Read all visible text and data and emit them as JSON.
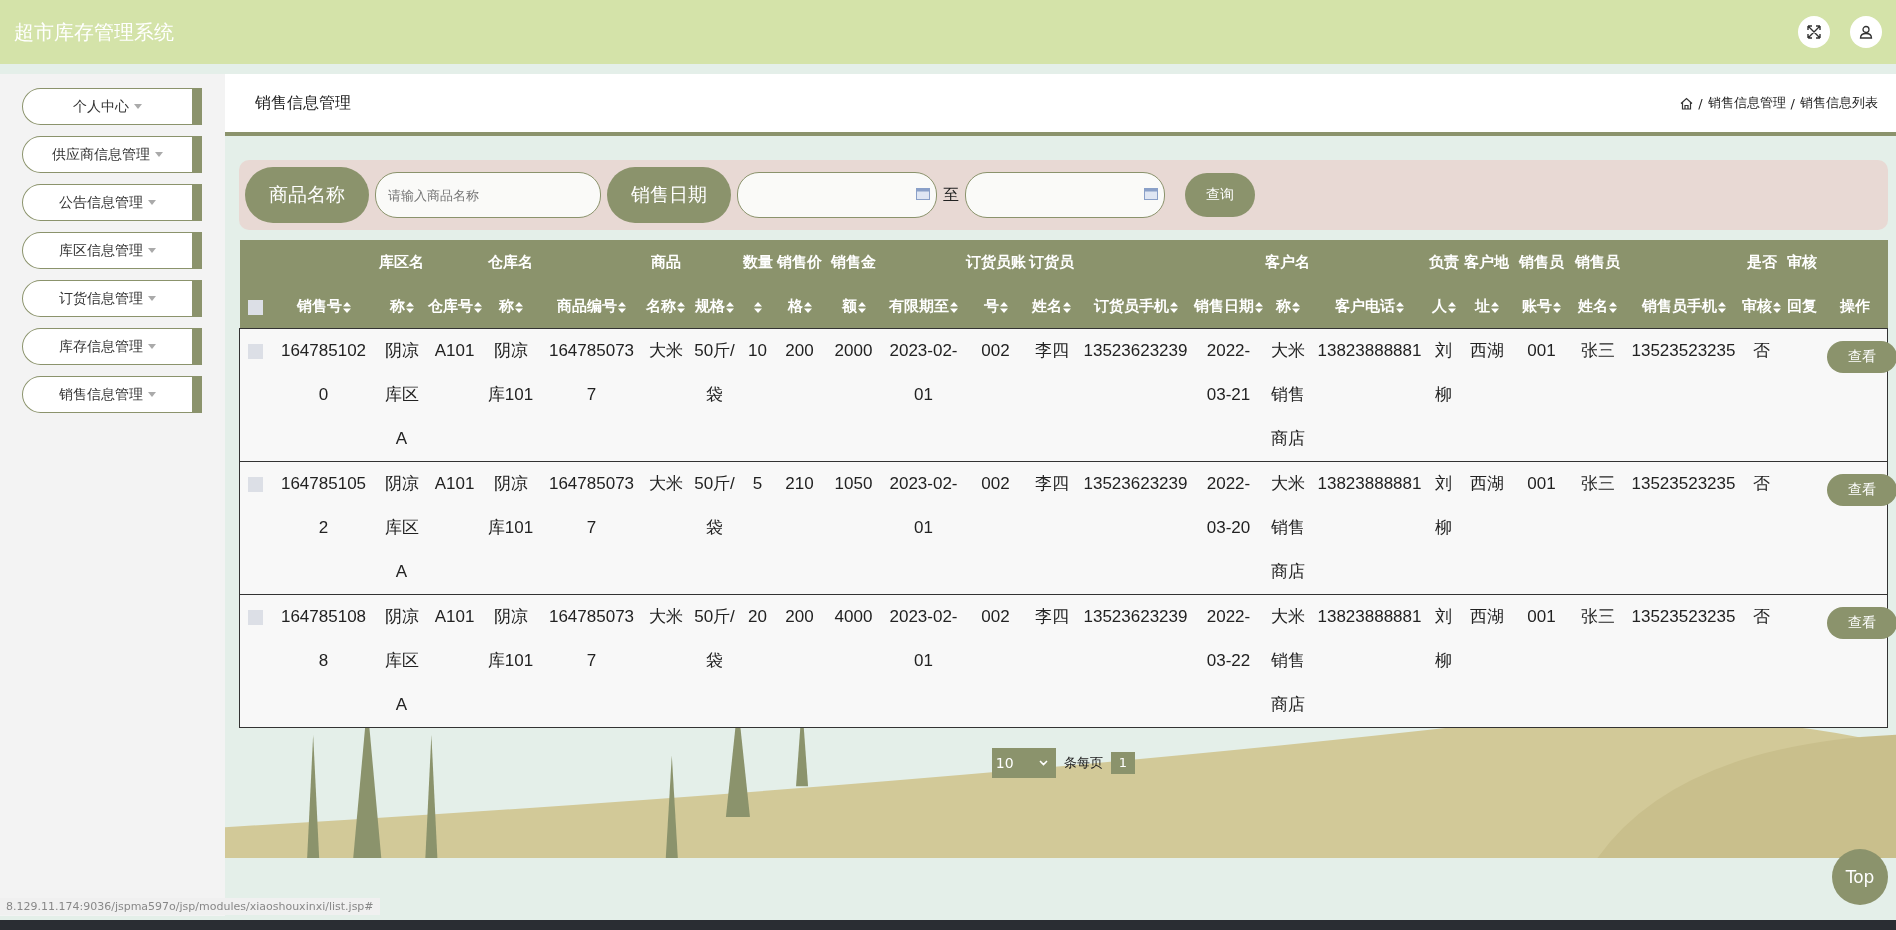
{
  "header": {
    "title": "超市库存管理系统"
  },
  "sidebar": {
    "items": [
      {
        "label": "个人中心",
        "selected": false
      },
      {
        "label": "供应商信息管理",
        "selected": false
      },
      {
        "label": "公告信息管理",
        "selected": false
      },
      {
        "label": "库区信息管理",
        "selected": false
      },
      {
        "label": "订货信息管理",
        "selected": false
      },
      {
        "label": "库存信息管理",
        "selected": false
      },
      {
        "label": "销售信息管理",
        "selected": false
      }
    ]
  },
  "page_title": "销售信息管理",
  "breadcrumb": {
    "separator": "/",
    "items": [
      "销售信息管理",
      "销售信息列表"
    ]
  },
  "search": {
    "fields": [
      {
        "label": "商品名称",
        "kind": "text",
        "placeholder": "请输入商品名称"
      },
      {
        "label": "销售日期",
        "kind": "daterange",
        "separator": "至"
      }
    ],
    "button": "查询"
  },
  "table": {
    "select_all": {
      "checked": false
    },
    "columns": [
      {
        "label": "销售号",
        "sortable": true
      },
      {
        "label": "库区名称",
        "sortable": true
      },
      {
        "label": "仓库号",
        "sortable": true
      },
      {
        "label": "仓库名称",
        "sortable": true
      },
      {
        "label": "商品编号",
        "sortable": true
      },
      {
        "label": "商品名称",
        "sortable": true
      },
      {
        "label": "规格",
        "sortable": true
      },
      {
        "label": "数量",
        "sortable": true
      },
      {
        "label": "销售价格",
        "sortable": true
      },
      {
        "label": "销售金额",
        "sortable": true
      },
      {
        "label": "有限期至",
        "sortable": true
      },
      {
        "label": "订货员账号",
        "sortable": true
      },
      {
        "label": "订货员姓名",
        "sortable": true
      },
      {
        "label": "订货员手机",
        "sortable": true
      },
      {
        "label": "销售日期",
        "sortable": true
      },
      {
        "label": "客户名称",
        "sortable": true
      },
      {
        "label": "客户电话",
        "sortable": true
      },
      {
        "label": "负责人",
        "sortable": true
      },
      {
        "label": "客户地址",
        "sortable": true
      },
      {
        "label": "销售员账号",
        "sortable": true
      },
      {
        "label": "销售员姓名",
        "sortable": true
      },
      {
        "label": "销售员手机",
        "sortable": true
      },
      {
        "label": "是否审核",
        "sortable": true
      },
      {
        "label": "审核回复",
        "sortable": false
      },
      {
        "label": "操作",
        "sortable": false
      }
    ],
    "rows": [
      {
        "checked": false,
        "cells": [
          "1647851020",
          "阴凉库区A",
          "A101",
          "阴凉库101",
          "1647850737",
          "大米",
          "50斤/袋",
          "10",
          "200",
          "2000",
          "2023-02-01",
          "002",
          "李四",
          "13523623239",
          "2022-03-21",
          "大米销售商店",
          "13823888881",
          "刘柳",
          "西湖",
          "001",
          "张三",
          "13523523235",
          "否",
          ""
        ],
        "action": "查看"
      },
      {
        "checked": false,
        "cells": [
          "1647851052",
          "阴凉库区A",
          "A101",
          "阴凉库101",
          "1647850737",
          "大米",
          "50斤/袋",
          "5",
          "210",
          "1050",
          "2023-02-01",
          "002",
          "李四",
          "13523623239",
          "2022-03-20",
          "大米销售商店",
          "13823888881",
          "刘柳",
          "西湖",
          "001",
          "张三",
          "13523523235",
          "否",
          ""
        ],
        "action": "查看"
      },
      {
        "checked": false,
        "cells": [
          "1647851088",
          "阴凉库区A",
          "A101",
          "阴凉库101",
          "1647850737",
          "大米",
          "50斤/袋",
          "20",
          "200",
          "4000",
          "2023-02-01",
          "002",
          "李四",
          "13523623239",
          "2022-03-22",
          "大米销售商店",
          "13823888881",
          "刘柳",
          "西湖",
          "001",
          "张三",
          "13523523235",
          "否",
          ""
        ],
        "action": "查看"
      }
    ]
  },
  "pagination": {
    "page_size": "10",
    "page_size_label": "条每页",
    "pages": [
      {
        "label": "1",
        "selected": true
      }
    ]
  },
  "top_button": "Top",
  "status_url": "8.129.11.174:9036/jspma597o/jsp/modules/xiaoshouxinxi/list.jsp#"
}
